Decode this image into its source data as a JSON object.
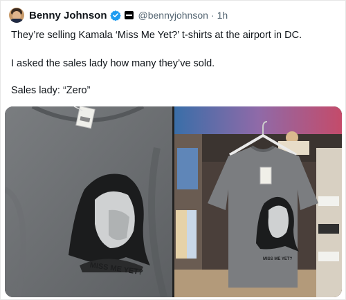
{
  "tweet": {
    "author_name": "Benny Johnson",
    "handle": "@bennyjohnson",
    "separator": "·",
    "time": "1h",
    "lines": [
      "They’re selling Kamala ‘Miss Me Yet?’ t-shirts at the airport in DC.",
      "I asked the sales lady how many they’ve sold.",
      "Sales lady: “Zero”"
    ]
  },
  "media": {
    "left_photo": {
      "shirt_print": "MISS ME YET?"
    },
    "right_photo": {
      "shirt_print": "MISS ME YET?"
    }
  },
  "colors": {
    "verified": "#1d9bf0",
    "handle": "#536471",
    "text": "#0f1419"
  },
  "icons": [
    "verified-badge-icon",
    "org-affiliation-icon"
  ]
}
